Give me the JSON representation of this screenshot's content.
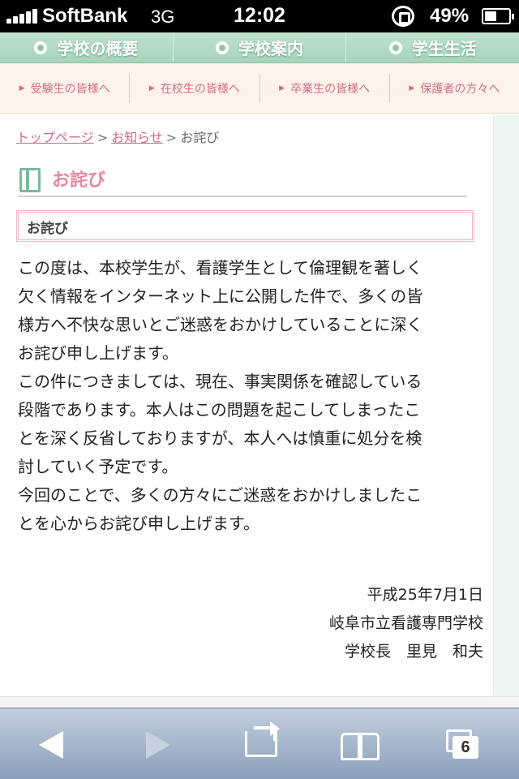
{
  "status_bar": {
    "carrier": "SoftBank",
    "network": "3G",
    "time": "12:02",
    "battery": "49%"
  },
  "main_nav": {
    "items": [
      {
        "label": "学校の概要"
      },
      {
        "label": "学校案内"
      },
      {
        "label": "学生生活"
      }
    ]
  },
  "sub_nav": {
    "items": [
      {
        "label": "受験生の皆様へ"
      },
      {
        "label": "在校生の皆様へ"
      },
      {
        "label": "卒業生の皆様へ"
      },
      {
        "label": "保護者の方々へ"
      }
    ]
  },
  "breadcrumb": {
    "top": "トップページ",
    "news": "お知らせ",
    "current": "お詫び",
    "separator": ">"
  },
  "page": {
    "title": "お詫び",
    "subheading": "お詫び",
    "lines": [
      "この度は、本校学生が、看護学生として倫理観を著しく",
      "欠く情報をインターネット上に公開した件で、多くの皆",
      "様方へ不快な思いとご迷惑をおかけしていることに深く",
      "お詫び申し上げます。",
      "この件につきましては、現在、事実関係を確認している",
      "段階であります。本人はこの問題を起こしてしまったこ",
      "とを深く反省しておりますが、本人へは慎重に処分を検",
      "討していく予定です。",
      "今回のことで、多くの方々にご迷惑をおかけしましたこ",
      "とを心からお詫び申し上げます。"
    ],
    "date": "平成25年7月1日",
    "school": "岐阜市立看護専門学校",
    "principal": "学校長　里見　和夫"
  },
  "toolbar": {
    "tab_count": "6"
  },
  "colors": {
    "accent_pink": "#d36a86",
    "nav_green": "#a6d4ba"
  }
}
